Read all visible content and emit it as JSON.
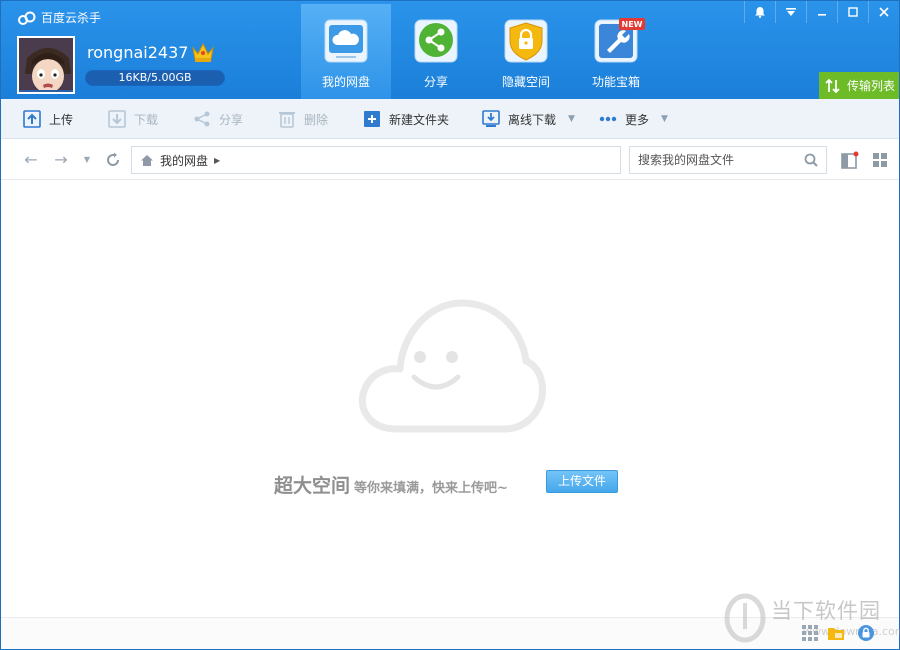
{
  "app": {
    "title": "百度云杀手"
  },
  "user": {
    "name": "rongnai2437",
    "quota": "16KB/5.00GB"
  },
  "nav_tabs": [
    {
      "label": "我的网盘",
      "icon": "cloud-drive-icon",
      "active": true
    },
    {
      "label": "分享",
      "icon": "share-icon",
      "active": false
    },
    {
      "label": "隐藏空间",
      "icon": "lock-icon",
      "active": false
    },
    {
      "label": "功能宝箱",
      "icon": "toolbox-icon",
      "active": false,
      "badge": "NEW"
    }
  ],
  "window_controls": [
    "bell-icon",
    "menu-icon",
    "minimize-icon",
    "maximize-icon",
    "close-icon"
  ],
  "transfer_button": {
    "label": "传输列表"
  },
  "toolbar": {
    "upload": "上传",
    "download": "下载",
    "share": "分享",
    "delete": "删除",
    "new_folder": "新建文件夹",
    "offline_download": "离线下载",
    "more": "更多"
  },
  "address": {
    "breadcrumb_root": "我的网盘",
    "search_placeholder": "搜索我的网盘文件"
  },
  "empty_state": {
    "headline": "超大空间",
    "subtext": "等你来填满，快来上传吧~",
    "button": "上传文件"
  },
  "watermark": {
    "text": "当下软件园",
    "url": "www.downxia.com"
  },
  "colors": {
    "header_blue": "#1e88e5",
    "active_tab": "#3aa1f1",
    "transfer_green": "#6dbb27",
    "upload_button": "#58b6f2"
  }
}
